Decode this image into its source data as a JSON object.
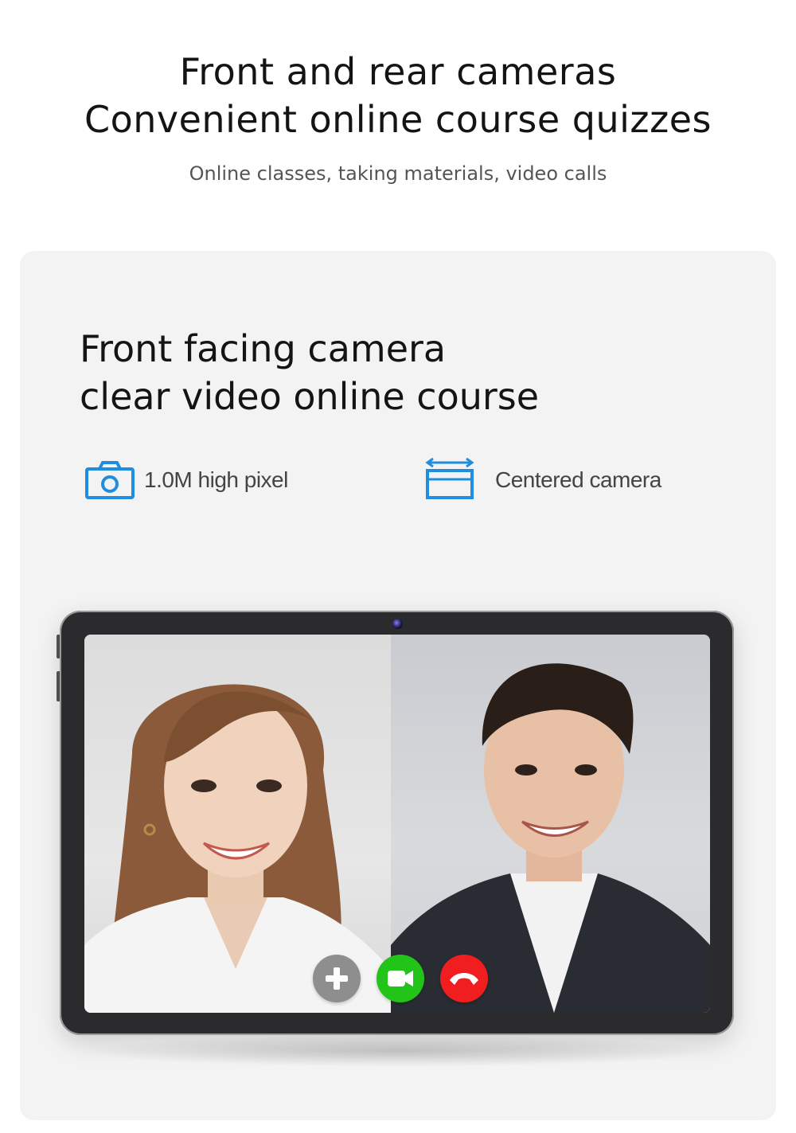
{
  "hero": {
    "title_line1": "Front and rear cameras",
    "title_line2": "Convenient online course quizzes",
    "subtitle": "Online classes, taking materials, video calls"
  },
  "panel": {
    "title_line1": "Front facing camera",
    "title_line2": "clear video online course"
  },
  "features": [
    {
      "label": "1.0M high pixel",
      "icon": "camera-icon"
    },
    {
      "label": "Centered camera",
      "icon": "centered-frame-icon"
    }
  ],
  "call_controls": {
    "add_icon": "plus-icon",
    "video_icon": "video-camera-icon",
    "end_icon": "hang-up-icon"
  },
  "colors": {
    "accent_blue": "#1f8de0",
    "add_gray": "#8e8e8e",
    "video_green": "#22c41a",
    "end_red": "#f01e1e"
  }
}
